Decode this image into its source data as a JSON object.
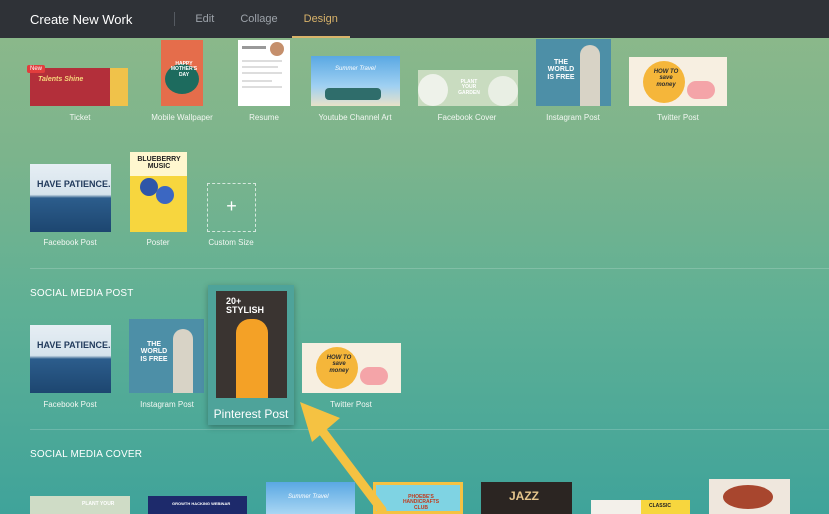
{
  "header": {
    "title": "Create New Work",
    "tabs": [
      {
        "label": "Edit",
        "active": false
      },
      {
        "label": "Collage",
        "active": false
      },
      {
        "label": "Design",
        "active": true
      }
    ]
  },
  "presets": {
    "items": [
      {
        "label": "Ticket",
        "thumb_text": "Talents Shine",
        "badge": "New"
      },
      {
        "label": "Mobile Wallpaper",
        "thumb_text": "HAPPY MOTHER'S DAY"
      },
      {
        "label": "Resume"
      },
      {
        "label": "Youtube Channel Art",
        "thumb_text": "Summer Travel"
      },
      {
        "label": "Facebook Cover",
        "thumb_text": "PLANT YOUR GARDEN"
      },
      {
        "label": "Instagram Post",
        "thumb_text": "THE WORLD IS FREE"
      },
      {
        "label": "Twitter Post",
        "thumb_text": "HOW TO save money"
      },
      {
        "label": "Facebook Post",
        "thumb_text": "HAVE PATIENCE."
      },
      {
        "label": "Poster",
        "thumb_text": "BLUEBERRY MUSIC"
      },
      {
        "label": "Custom Size",
        "icon": "plus-icon"
      }
    ]
  },
  "social_post": {
    "title": "SOCIAL MEDIA POST",
    "items": [
      {
        "label": "Facebook Post",
        "thumb_text": "HAVE PATIENCE."
      },
      {
        "label": "Instagram Post",
        "thumb_text": "THE WORLD IS FREE"
      },
      {
        "label": "Pinterest Post",
        "thumb_text": "20+ STYLISH"
      },
      {
        "label": "Twitter Post",
        "thumb_text": "HOW TO save money"
      }
    ]
  },
  "social_cover": {
    "title": "SOCIAL MEDIA COVER",
    "items": [
      {
        "thumb_text": "PLANT YOUR"
      },
      {
        "thumb_text": "GROWTH HACKING WEBINAR"
      },
      {
        "thumb_text": "Summer Travel"
      },
      {
        "thumb_text": "PHOEBE'S HANDICRAFTS CLUB"
      },
      {
        "thumb_text": "JAZZ"
      },
      {
        "thumb_text": "CLASSIC"
      },
      {
        "thumb_text": ""
      }
    ]
  },
  "colors": {
    "topbar": "#2f3237",
    "active_tab": "#d9b36a",
    "arrow": "#f5c242"
  }
}
